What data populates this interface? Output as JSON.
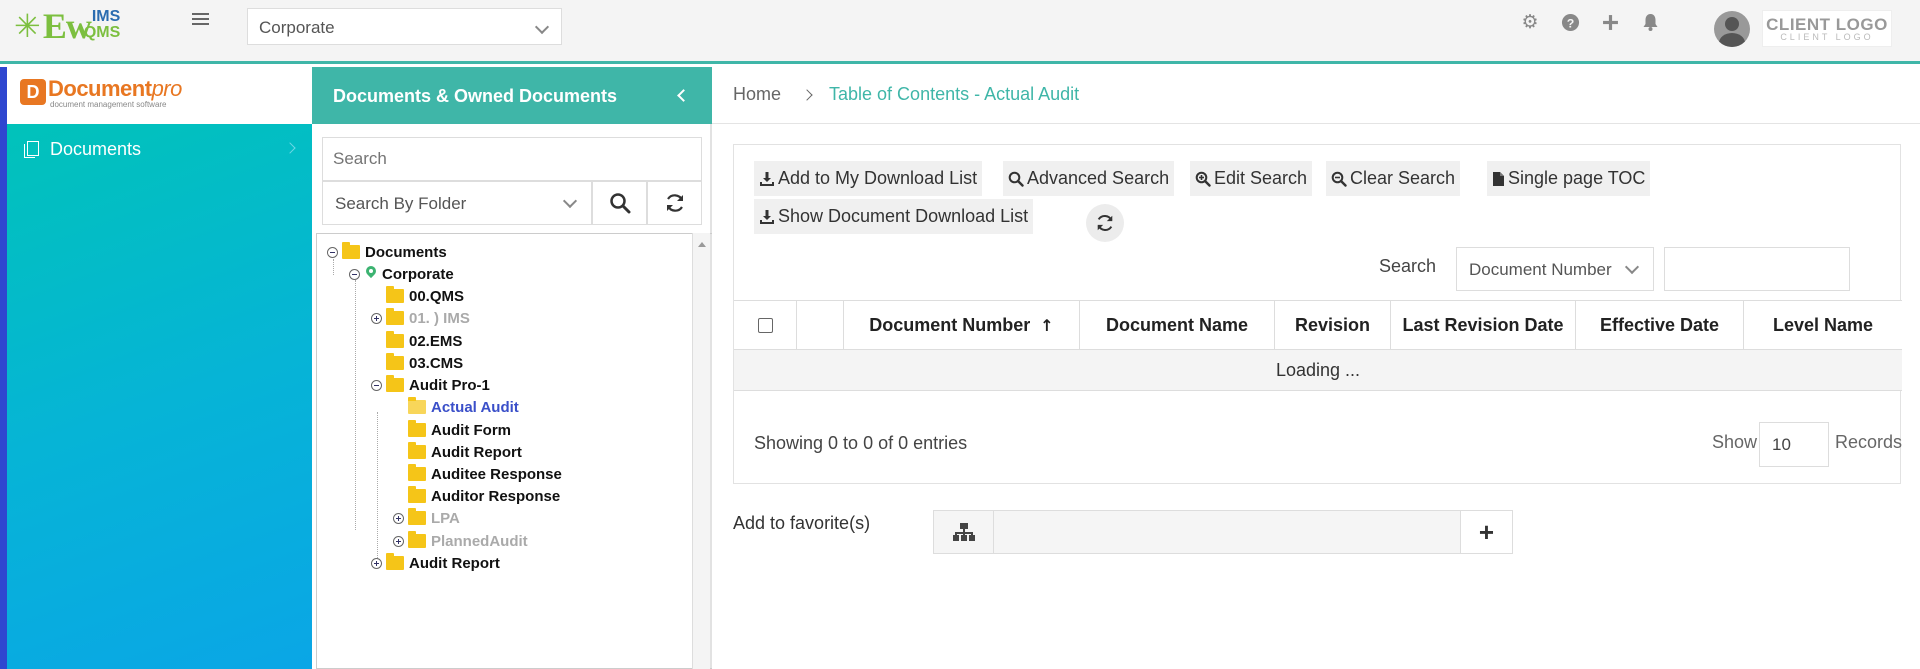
{
  "brand": {
    "logo_main": "Ew",
    "logo_ims": "IMS",
    "logo_qms": "QMS",
    "star_glyph": "✳"
  },
  "header": {
    "org_select": "Corporate",
    "client_logo_line1": "CLIENT LOGO",
    "client_logo_line2": "CLIENT LOGO",
    "icons": [
      "gear-icon",
      "help-icon",
      "plus-icon",
      "bell-icon",
      "avatar"
    ]
  },
  "sidebar": {
    "product_logo": "Document",
    "product_logo_suffix": "pro",
    "product_tagline": "document management software",
    "items": [
      {
        "label": "Documents",
        "icon": "documents-icon"
      }
    ]
  },
  "tree_panel": {
    "title": "Documents & Owned Documents",
    "search_placeholder": "Search",
    "folder_select": "Search By Folder",
    "nodes": [
      {
        "label": "Documents"
      },
      {
        "label": "Corporate"
      },
      {
        "label": "00.QMS"
      },
      {
        "label": "01. ) IMS"
      },
      {
        "label": "02.EMS"
      },
      {
        "label": "03.CMS"
      },
      {
        "label": "Audit Pro-1"
      },
      {
        "label": "Actual Audit"
      },
      {
        "label": "Audit Form"
      },
      {
        "label": "Audit Report"
      },
      {
        "label": "Auditee Response"
      },
      {
        "label": "Auditor Response"
      },
      {
        "label": "LPA"
      },
      {
        "label": "PlannedAudit"
      },
      {
        "label": "Audit Report"
      }
    ]
  },
  "breadcrumb": {
    "home": "Home",
    "current": "Table of Contents - Actual Audit"
  },
  "toolbar": {
    "add_download": "Add to My Download List",
    "advanced_search": "Advanced Search",
    "edit_search": "Edit Search",
    "clear_search": "Clear Search",
    "single_toc": "Single page TOC",
    "show_download": "Show Document Download List"
  },
  "search": {
    "label": "Search",
    "field": "Document Number",
    "value": ""
  },
  "table": {
    "columns": [
      "Document Number",
      "Document Name",
      "Revision",
      "Last Revision Date",
      "Effective Date",
      "Level Name"
    ],
    "sort_column": "Document Number",
    "sort_indicator": "↑",
    "loading_text": "Loading ...",
    "showing_text": "Showing 0 to 0 of 0 entries",
    "show_label": "Show",
    "page_size": "10",
    "records_label": "Records"
  },
  "favorites": {
    "label": "Add to favorite(s)",
    "add_symbol": "+"
  },
  "colors": {
    "accent": "#3fb6a8",
    "selected_node": "#3a4fc9",
    "folder": "#f5c518",
    "sidebar_stripe": "#2f47d0"
  }
}
